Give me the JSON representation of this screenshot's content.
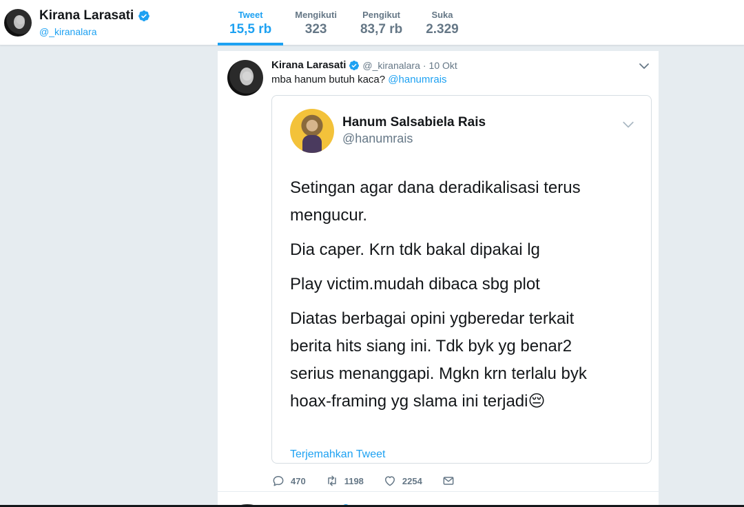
{
  "profile": {
    "name": "Kirana Larasati",
    "handle": "@_kiranalara"
  },
  "stats": [
    {
      "label": "Tweet",
      "value": "15,5 rb",
      "active": true
    },
    {
      "label": "Mengikuti",
      "value": "323",
      "active": false
    },
    {
      "label": "Pengikut",
      "value": "83,7 rb",
      "active": false
    },
    {
      "label": "Suka",
      "value": "2.329",
      "active": false
    }
  ],
  "tweet": {
    "author_name": "Kirana Larasati",
    "author_handle": "@_kiranalara",
    "separator": "·",
    "time": "10 Okt",
    "text": "mba hanum butuh kaca?",
    "mention": "@hanumrais",
    "media": {
      "name": "Hanum Salsabiela Rais",
      "handle": "@hanumrais",
      "paragraphs": [
        [
          "Setingan agar dana deradikalisasi terus",
          "mengucur."
        ],
        [
          "Dia caper. Krn tdk bakal dipakai lg"
        ],
        [
          "Play victim.mudah dibaca sbg plot"
        ],
        [
          "Diatas berbagai opini ygberedar terkait",
          "berita hits siang ini. Tdk byk yg benar2",
          "serius menanggapi. Mgkn krn terlalu byk",
          "hoax-framing yg slama ini terjadi"
        ]
      ],
      "emoji": "😔",
      "translate": "Terjemahkan Tweet"
    },
    "actions": {
      "replies": "470",
      "retweets": "1198",
      "likes": "2254"
    }
  },
  "icons": {
    "verified": "verified-badge-icon",
    "caret": "chevron-down-icon",
    "reply": "reply-icon",
    "retweet": "retweet-icon",
    "like": "heart-icon",
    "message": "direct-message-icon"
  },
  "colors": {
    "accent": "#1da1f2",
    "background": "#e6ecf0",
    "secondary_text": "#657786"
  }
}
